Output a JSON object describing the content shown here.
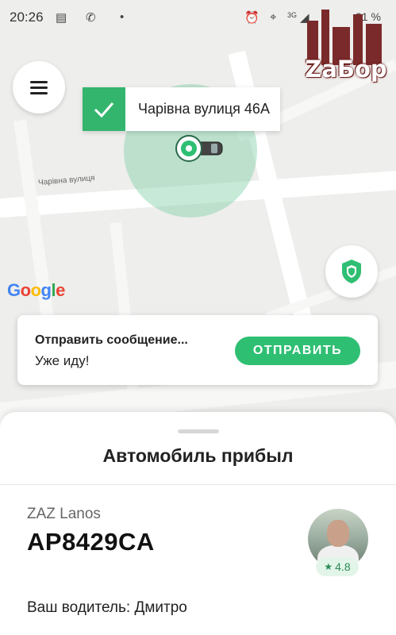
{
  "status_bar": {
    "time": "20:26",
    "battery": "31 %",
    "network": "3G"
  },
  "logo": {
    "text": "ZаБор"
  },
  "map": {
    "address_label": "Чарівна вулиця 46А",
    "street_label": "Чарівна вулиця",
    "google_label": "Google",
    "accent_color": "#34b56e"
  },
  "message_card": {
    "title": "Отправить сообщение...",
    "subtitle": "Уже иду!",
    "send_button": "ОТПРАВИТЬ"
  },
  "sheet": {
    "title": "Автомобиль прибыл",
    "car_model": "ZAZ Lanos",
    "plate": "AP8429CA",
    "rating": "4.8",
    "driver_text": "Ваш водитель: Дмитро"
  }
}
